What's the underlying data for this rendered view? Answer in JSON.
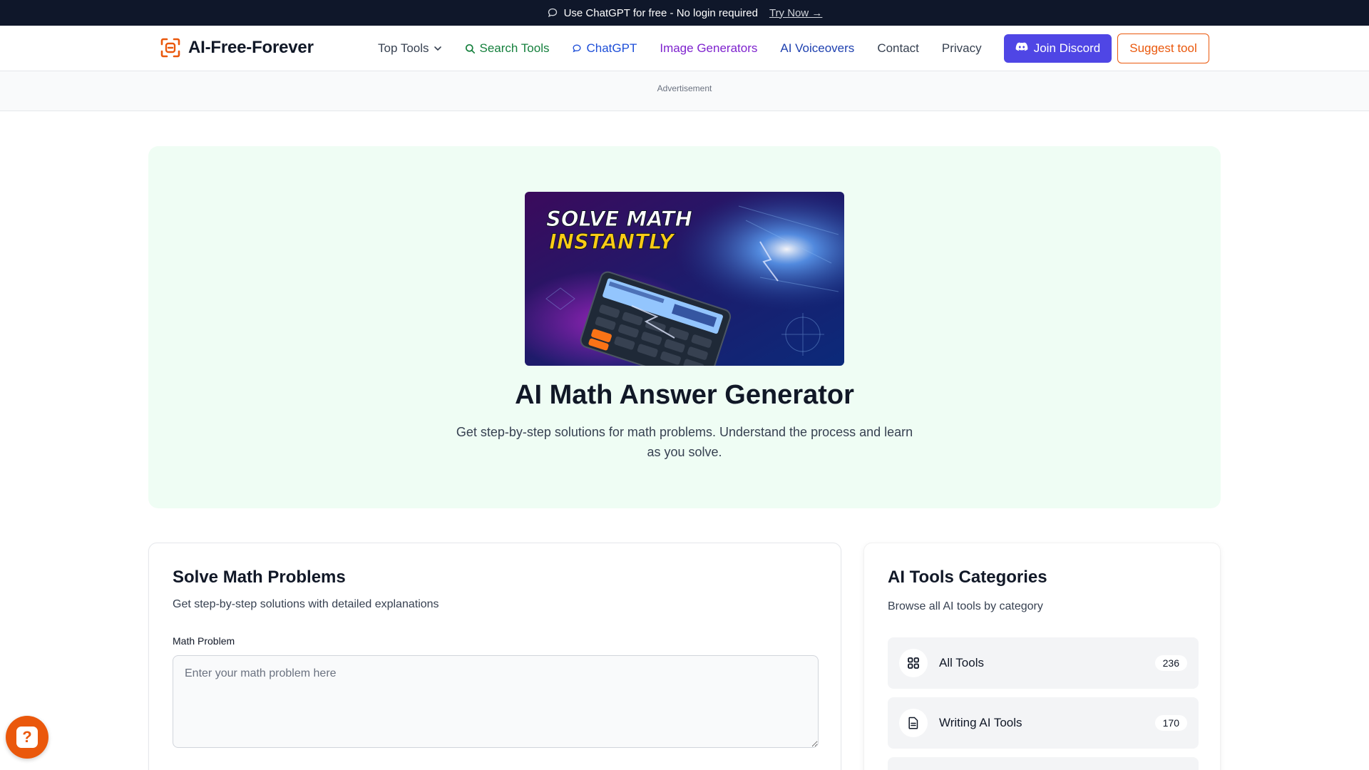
{
  "banner": {
    "icon": "chat-bubble-icon",
    "text": "Use ChatGPT for free - No login required",
    "link": "Try Now →"
  },
  "nav": {
    "logo_text": "AI-Free-Forever",
    "logo_icon": "scan-frame-icon",
    "links": [
      {
        "label": "Top Tools",
        "icon": "chevron-down-icon"
      },
      {
        "label": "Search Tools",
        "icon": "search-icon"
      },
      {
        "label": "ChatGPT",
        "icon": "chat-bubble-icon"
      },
      {
        "label": "Image Generators"
      },
      {
        "label": "AI Voiceovers"
      },
      {
        "label": "Contact"
      },
      {
        "label": "Privacy"
      }
    ],
    "discord_label": "Join Discord",
    "suggest_label": "Suggest tool"
  },
  "ad": {
    "label": "Advertisement"
  },
  "hero": {
    "image_text_line1": "SOLVE MATH",
    "image_text_line2": "INSTANTLY",
    "title": "AI Math Answer Generator",
    "subtitle": "Get step-by-step solutions for math problems. Understand the process and learn as you solve."
  },
  "solver": {
    "title": "Solve Math Problems",
    "subtitle": "Get step-by-step solutions with detailed explanations",
    "field_label": "Math Problem",
    "placeholder": "Enter your math problem here",
    "value": ""
  },
  "categories": {
    "title": "AI Tools Categories",
    "subtitle": "Browse all AI tools by category",
    "items": [
      {
        "label": "All Tools",
        "count": "236",
        "icon": "grid-icon"
      },
      {
        "label": "Writing AI Tools",
        "count": "170",
        "icon": "document-icon"
      }
    ]
  },
  "colors": {
    "accent_orange": "#ea580c",
    "discord_indigo": "#4f46e5",
    "hero_bg": "#effdf4",
    "banner_bg": "#0f172a"
  }
}
